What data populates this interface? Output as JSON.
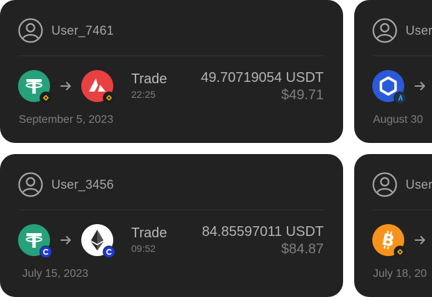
{
  "cards": [
    {
      "user": "User_7461",
      "action": "Trade",
      "time": "22:25",
      "amount": "49.70719054 USDT",
      "fiat": "$49.71",
      "date": "September 5, 2023",
      "from_icon": "tether-icon",
      "to_icon": "avalanche-icon",
      "chain_icon": "binance-icon"
    },
    {
      "user": "User_3456",
      "action": "Trade",
      "time": "09:52",
      "amount": "84.85597011 USDT",
      "fiat": "$84.87",
      "date": "July 15, 2023",
      "from_icon": "tether-icon",
      "to_icon": "ethereum-icon",
      "chain_icon": "cronos-icon"
    },
    {
      "user": "User",
      "date": "August 30",
      "from_icon": "chainlink-icon",
      "chain_icon": "arbitrum-icon"
    },
    {
      "user": "User",
      "date": "July 18, 20",
      "from_icon": "bitcoin-icon",
      "chain_icon": "binance-icon"
    }
  ],
  "colors": {
    "page_background": "#ffffff",
    "card_background": "#222222",
    "tether": "#26a17b",
    "avalanche": "#e84142",
    "chainlink": "#2a5ada",
    "bitcoin": "#f7931a",
    "binance": "#f0b90b",
    "cronos": "#1d3ad6"
  }
}
